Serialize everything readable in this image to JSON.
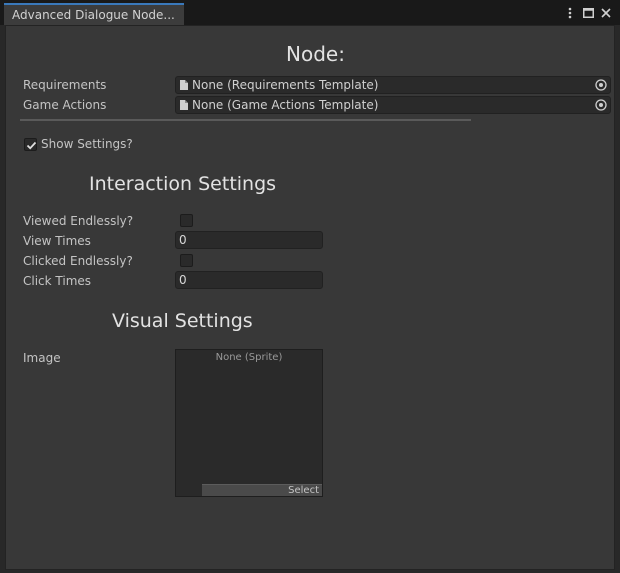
{
  "window": {
    "tab_title": "Advanced Dialogue Node...",
    "controls": [
      "more-icon",
      "maximize-icon",
      "close-icon"
    ]
  },
  "node": {
    "heading": "Node:",
    "requirements": {
      "label": "Requirements",
      "value": "None (Requirements Template)"
    },
    "game_actions": {
      "label": "Game Actions",
      "value": "None (Game Actions Template)"
    }
  },
  "show_settings": {
    "label": "Show Settings?",
    "checked": true
  },
  "interaction_settings": {
    "heading": "Interaction Settings",
    "viewed_endlessly": {
      "label": "Viewed Endlessly?",
      "checked": false
    },
    "view_times": {
      "label": "View Times",
      "value": "0"
    },
    "clicked_endlessly": {
      "label": "Clicked Endlessly?",
      "checked": false
    },
    "click_times": {
      "label": "Click Times",
      "value": "0"
    }
  },
  "visual_settings": {
    "heading": "Visual Settings",
    "image": {
      "label": "Image",
      "value": "None (Sprite)",
      "select_label": "Select"
    }
  },
  "colors": {
    "accent": "#3a79bb",
    "panel": "#383838",
    "field": "#2a2a2a"
  }
}
